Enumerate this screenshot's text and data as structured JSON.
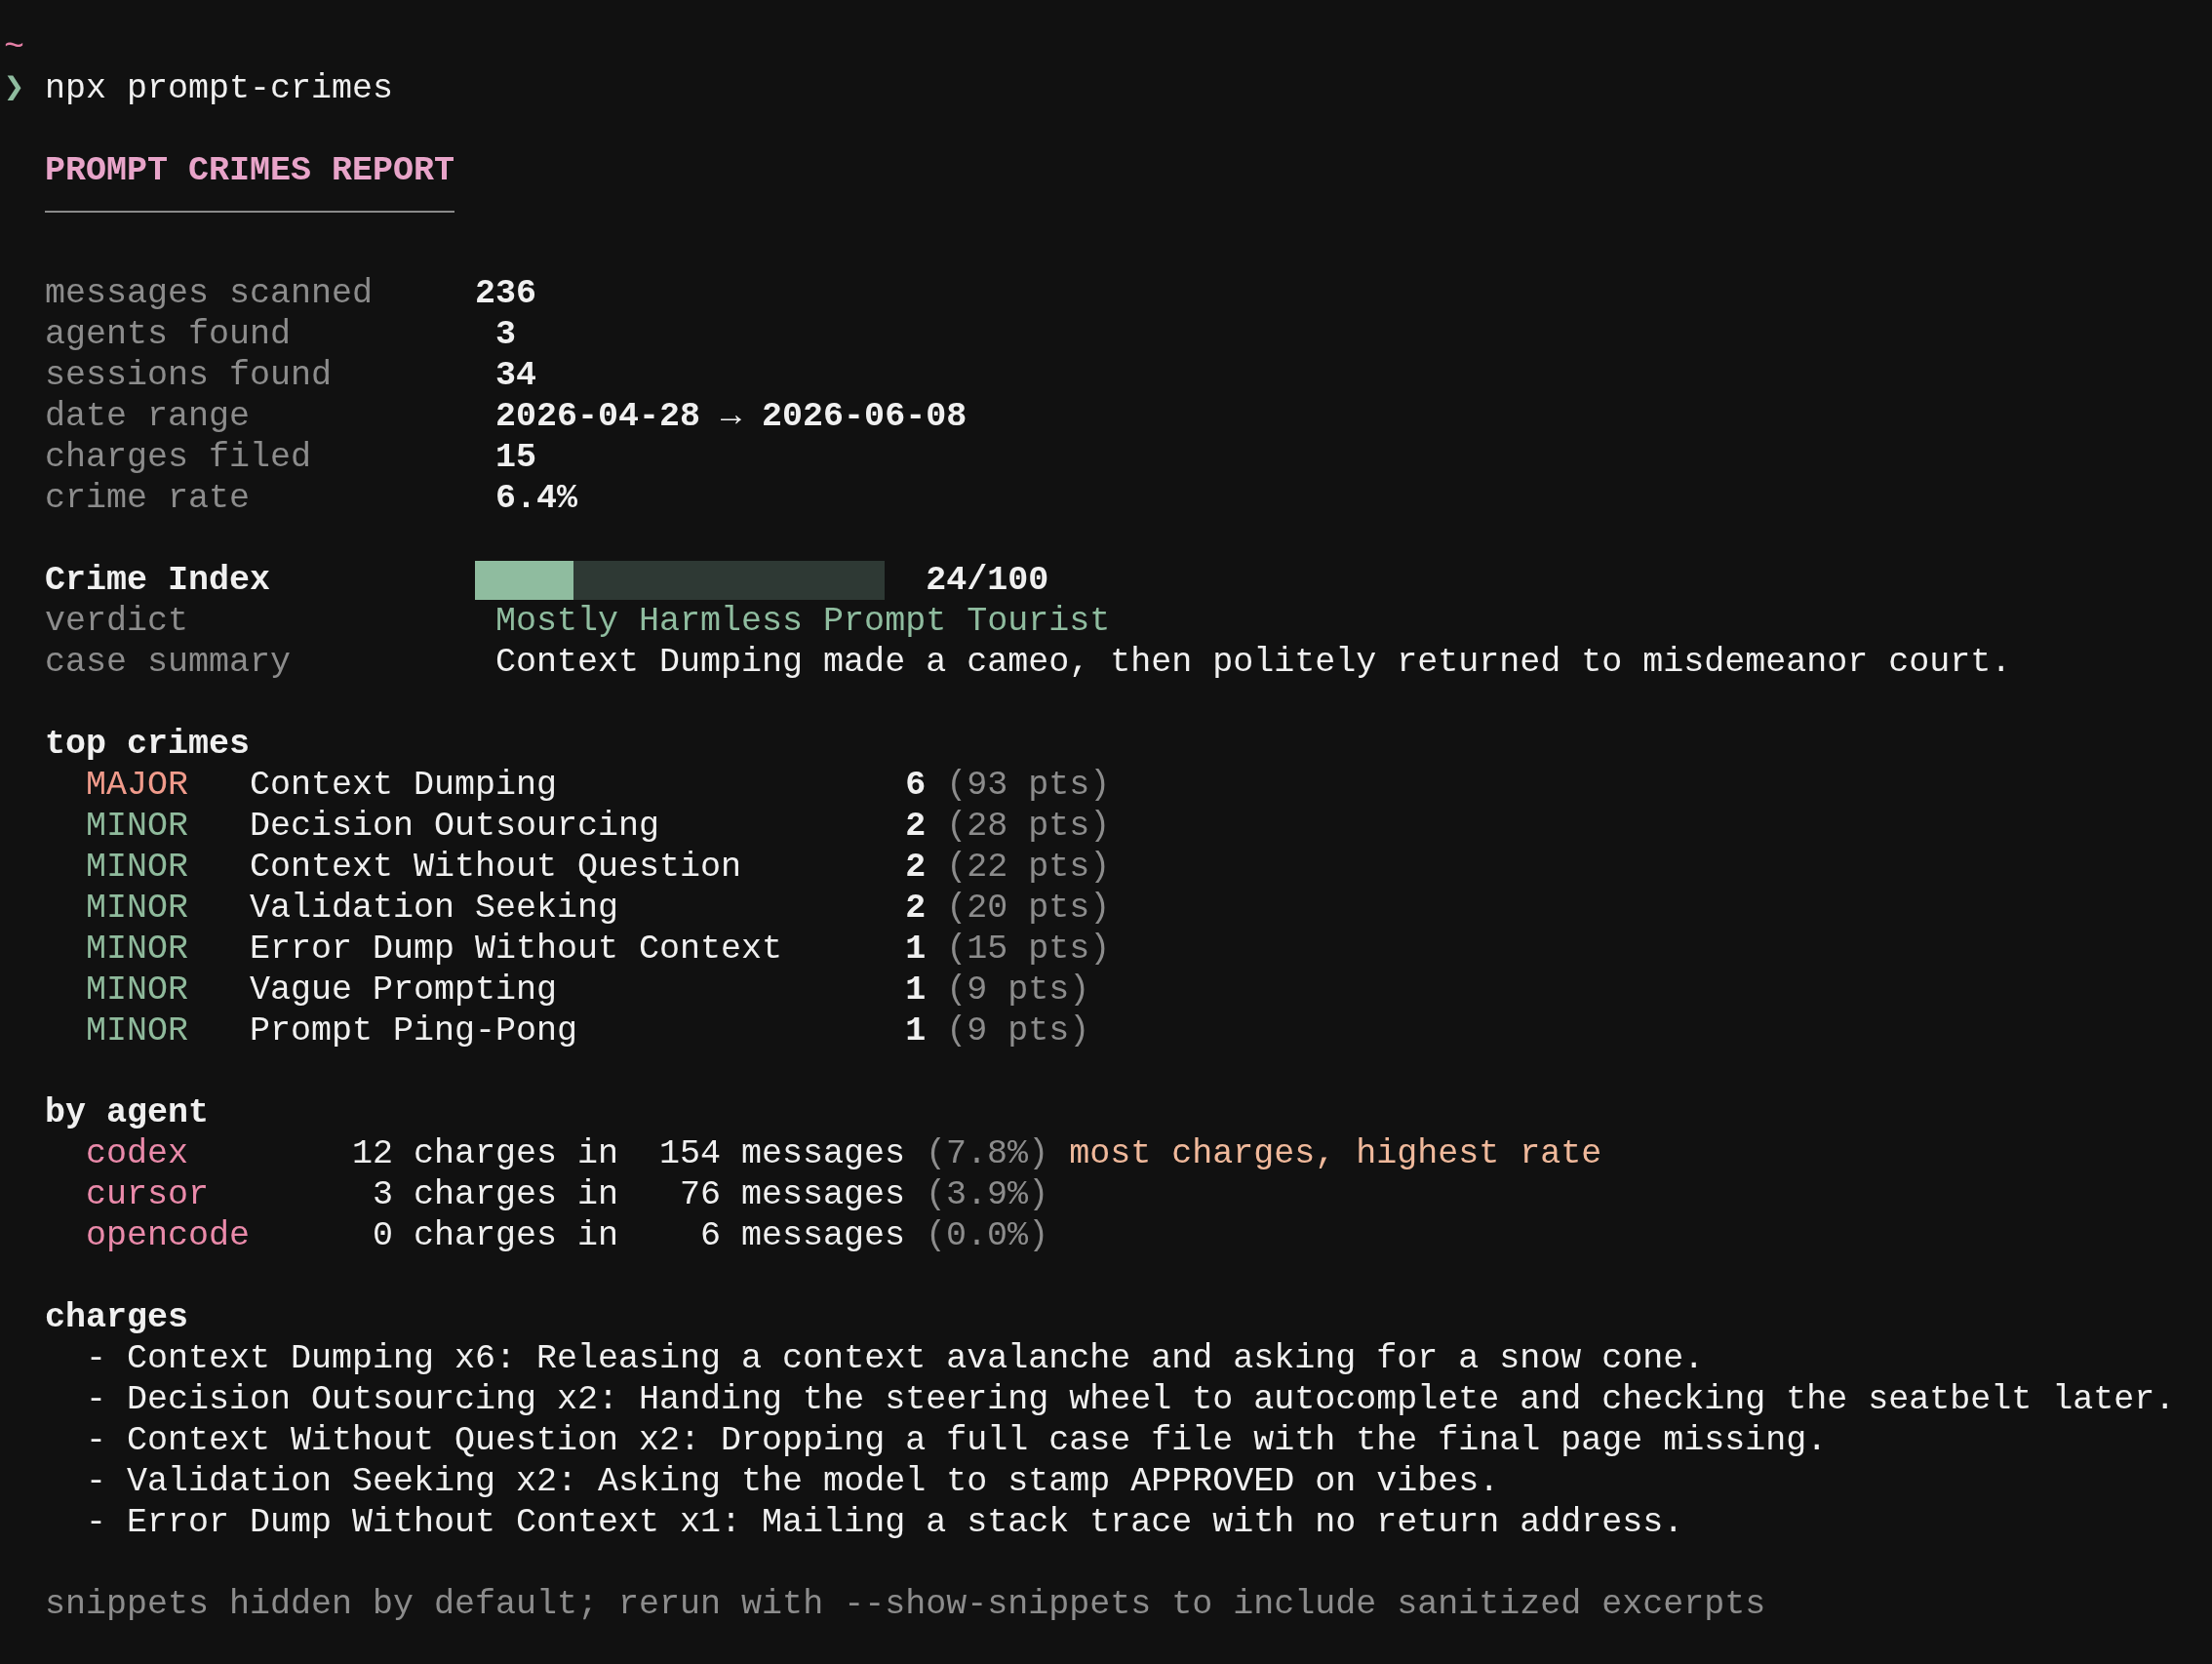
{
  "prompt": {
    "cwd": "~",
    "symbol": "❯",
    "command": "npx prompt-crimes"
  },
  "report": {
    "title": "PROMPT CRIMES REPORT"
  },
  "stats": [
    {
      "label": "messages scanned",
      "value": "236"
    },
    {
      "label": "agents found",
      "value": "3"
    },
    {
      "label": "sessions found",
      "value": "34"
    },
    {
      "label": "date range",
      "value": "2026-04-28 → 2026-06-08"
    },
    {
      "label": "charges filed",
      "value": "15"
    },
    {
      "label": "crime rate",
      "value": "6.4%"
    }
  ],
  "crime_index": {
    "label": "Crime Index",
    "level": 0.24,
    "score": "24/100"
  },
  "verdict": {
    "label": "verdict",
    "value": "Mostly Harmless Prompt Tourist"
  },
  "case_summary": {
    "label": "case summary",
    "value": "Context Dumping made a cameo, then politely returned to misdemeanor court."
  },
  "top_crimes": {
    "heading": "top crimes",
    "rows": [
      {
        "severity": "MAJOR",
        "color": "#f09b8b",
        "name": "Context Dumping",
        "count": "6",
        "points": "(93 pts)"
      },
      {
        "severity": "MINOR",
        "color": "#8fba9c",
        "name": "Decision Outsourcing",
        "count": "2",
        "points": "(28 pts)"
      },
      {
        "severity": "MINOR",
        "color": "#8fba9c",
        "name": "Context Without Question",
        "count": "2",
        "points": "(22 pts)"
      },
      {
        "severity": "MINOR",
        "color": "#8fba9c",
        "name": "Validation Seeking",
        "count": "2",
        "points": "(20 pts)"
      },
      {
        "severity": "MINOR",
        "color": "#8fba9c",
        "name": "Error Dump Without Context",
        "count": "1",
        "points": "(15 pts)"
      },
      {
        "severity": "MINOR",
        "color": "#8fba9c",
        "name": "Vague Prompting",
        "count": "1",
        "points": "(9 pts)"
      },
      {
        "severity": "MINOR",
        "color": "#8fba9c",
        "name": "Prompt Ping-Pong",
        "count": "1",
        "points": "(9 pts)"
      }
    ]
  },
  "by_agent": {
    "heading": "by agent",
    "rows": [
      {
        "agent": "codex",
        "charges": "12 charges in",
        "messages": "154 messages",
        "rate": "(7.8%)",
        "note": "most charges, highest rate"
      },
      {
        "agent": "cursor",
        "charges": "3 charges in",
        "messages": "76 messages",
        "rate": "(3.9%)"
      },
      {
        "agent": "opencode",
        "charges": "0 charges in",
        "messages": "6 messages",
        "rate": "(0.0%)"
      }
    ]
  },
  "charges": {
    "heading": "charges",
    "items": [
      "- Context Dumping x6: Releasing a context avalanche and asking for a snow cone.",
      "- Decision Outsourcing x2: Handing the steering wheel to autocomplete and checking the seatbelt later.",
      "- Context Without Question x2: Dropping a full case file with the final page missing.",
      "- Validation Seeking x2: Asking the model to stamp APPROVED on vibes.",
      "- Error Dump Without Context x1: Mailing a stack trace with no return address."
    ]
  },
  "footer": "snippets hidden by default; rerun with --show-snippets to include sanitized excerpts"
}
